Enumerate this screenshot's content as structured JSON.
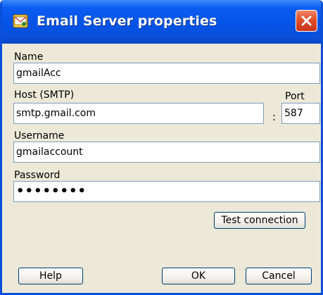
{
  "window": {
    "title": "Email Server properties"
  },
  "form": {
    "name_label": "Name",
    "name_value": "gmailAcc",
    "host_label": "Host (SMTP)",
    "host_value": "smtp.gmail.com",
    "port_label": "Port",
    "port_separator": ":",
    "port_value": "587",
    "username_label": "Username",
    "username_value": "gmailaccount",
    "password_label": "Password",
    "password_value": "••••••••"
  },
  "buttons": {
    "test_connection": "Test connection",
    "help": "Help",
    "ok": "OK",
    "cancel": "Cancel"
  },
  "icons": {
    "app": "mail-server-icon",
    "close": "close-icon"
  },
  "colors": {
    "titlebar": "#0a4fd9",
    "close": "#e14d29",
    "dialog_bg": "#ece9d8"
  }
}
